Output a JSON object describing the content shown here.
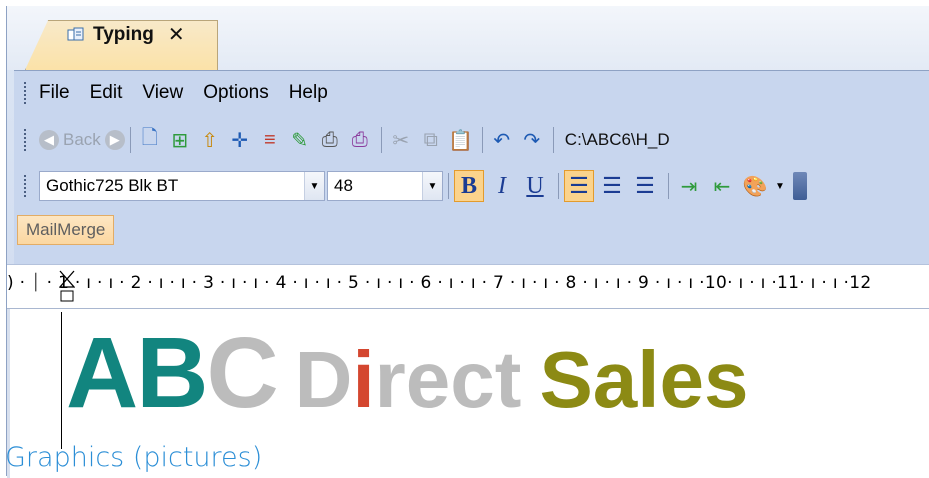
{
  "tab": {
    "title": "Typing",
    "close": "✕"
  },
  "menu": [
    "File",
    "Edit",
    "View",
    "Options",
    "Help"
  ],
  "toolbar": {
    "back_label": "Back",
    "path": "C:\\ABC6\\H_D"
  },
  "format": {
    "font_name": "Gothic725 Blk BT",
    "font_size": "48",
    "bold": "B",
    "italic": "I",
    "underline": "U"
  },
  "mailmerge": {
    "label": "MailMerge"
  },
  "ruler": {
    "text": ") · ⏐ · 1 · ı · ı · 2 · ı · ı · 3 · ı · ı · 4 · ı · ı · 5 · ı · ı · 6 · ı · ı · 7 · ı · ı · 8 · ı · ı · 9 · ı · ı ·10· ı · ı ·11· ı · ı ·12"
  },
  "document": {
    "banner": {
      "abc_1": "AB",
      "abc_2": "C",
      "direct_d": "D",
      "direct_i": "i",
      "direct_rest": "rect",
      "sales": "Sales"
    }
  },
  "caption": "Graphics (pictures)",
  "colors": {
    "teal": "#12857f",
    "grey": "#bcbcbc",
    "red": "#d4462f",
    "olive": "#8c8a14",
    "caption_blue": "#2b8ed6"
  }
}
